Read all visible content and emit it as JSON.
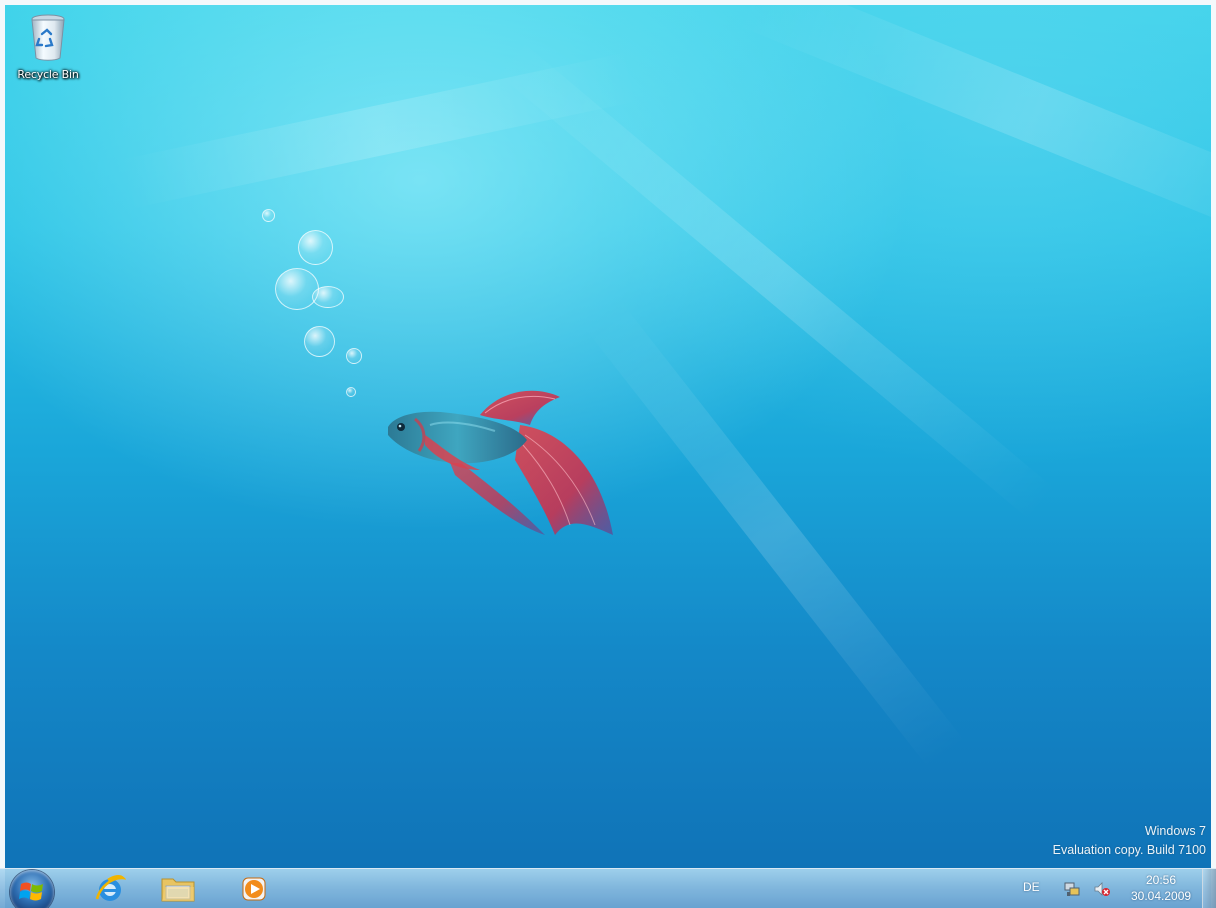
{
  "desktop": {
    "icons": [
      {
        "label": "Recycle Bin",
        "icon": "recycle-bin-icon"
      }
    ],
    "watermark": {
      "line1": "Windows 7",
      "line2": "Evaluation copy. Build 7100"
    }
  },
  "taskbar": {
    "start_icon": "windows-logo-icon",
    "pinned": [
      {
        "name": "Internet Explorer",
        "icon": "internet-explorer-icon"
      },
      {
        "name": "Windows Explorer",
        "icon": "folder-icon"
      },
      {
        "name": "Windows Media Player",
        "icon": "media-player-icon"
      }
    ],
    "tray": {
      "language": "DE",
      "network_icon": "network-icon",
      "volume_icon": "volume-muted-icon",
      "time": "20:56",
      "date": "30.04.2009"
    }
  }
}
